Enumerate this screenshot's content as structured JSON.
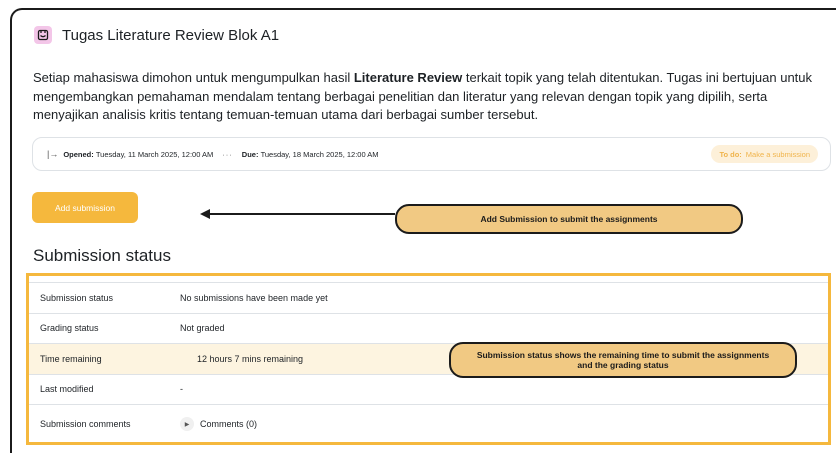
{
  "assignment": {
    "title": "Tugas Literature Review Blok A1",
    "description": {
      "part1": "Setiap mahasiswa dimohon untuk mengumpulkan hasil ",
      "bold": "Literature Review",
      "part2": " terkait topik yang telah ditentukan. Tugas ini bertujuan untuk mengembangkan pemahaman mendalam tentang berbagai penelitian dan literatur yang relevan dengan topik yang dipilih, serta menyajikan analisis kritis tentang temuan-temuan utama dari berbagai sumber tersebut."
    }
  },
  "dates": {
    "opened_label": "Opened:",
    "opened_value": "Tuesday, 11 March 2025, 12:00 AM",
    "separator": "···",
    "due_label": "Due:",
    "due_value": "Tuesday, 18 March 2025, 12:00 AM",
    "todo_label": "To do:",
    "todo_value": "Make a submission"
  },
  "actions": {
    "add_submission": "Add submission"
  },
  "annotations": {
    "add_submission_note": "Add Submission to submit the assignments",
    "status_note": "Submission status shows the remaining time to submit the assignments and the grading status"
  },
  "submission_status": {
    "heading": "Submission status",
    "rows": [
      {
        "label": "Submission status",
        "value": "No submissions have been made yet"
      },
      {
        "label": "Grading status",
        "value": "Not graded"
      },
      {
        "label": "Time remaining",
        "value": "12 hours 7 mins remaining"
      },
      {
        "label": "Last modified",
        "value": "-"
      },
      {
        "label": "Submission comments",
        "value": "Comments (0)"
      }
    ]
  },
  "colors": {
    "accent": "#f5b83d",
    "callout": "#f1c983",
    "highlight_row": "#fdf4e0",
    "todo_bg": "#fdf0d9",
    "module_icon": "#f3c6e8"
  },
  "icons": {
    "module": "assignment-icon",
    "opened": "arrow-into-bar-icon",
    "comments_toggle": "triangle-right-icon"
  }
}
